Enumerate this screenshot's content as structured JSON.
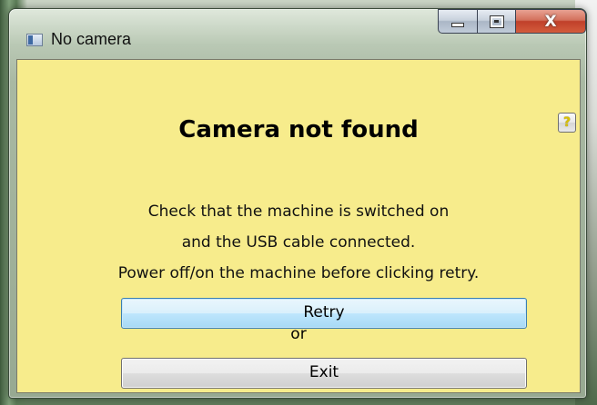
{
  "window": {
    "title": "No camera",
    "icon": "app-window-icon",
    "caption_buttons": {
      "minimize_icon": "minimize-icon",
      "maximize_icon": "maximize-icon",
      "close_icon": "close-icon",
      "close_glyph": "X"
    }
  },
  "dialog": {
    "heading": "Camera not found",
    "help_glyph": "?",
    "message_lines": [
      "Check that the machine is switched on",
      "and the USB cable connected.",
      "Power off/on the machine before clicking retry."
    ],
    "retry_label": "Retry",
    "or_label": "or",
    "exit_label": "Exit"
  },
  "colors": {
    "client_background": "#f7ec8c",
    "retry_accent": "#bee6fd",
    "close_button": "#c0402a"
  }
}
